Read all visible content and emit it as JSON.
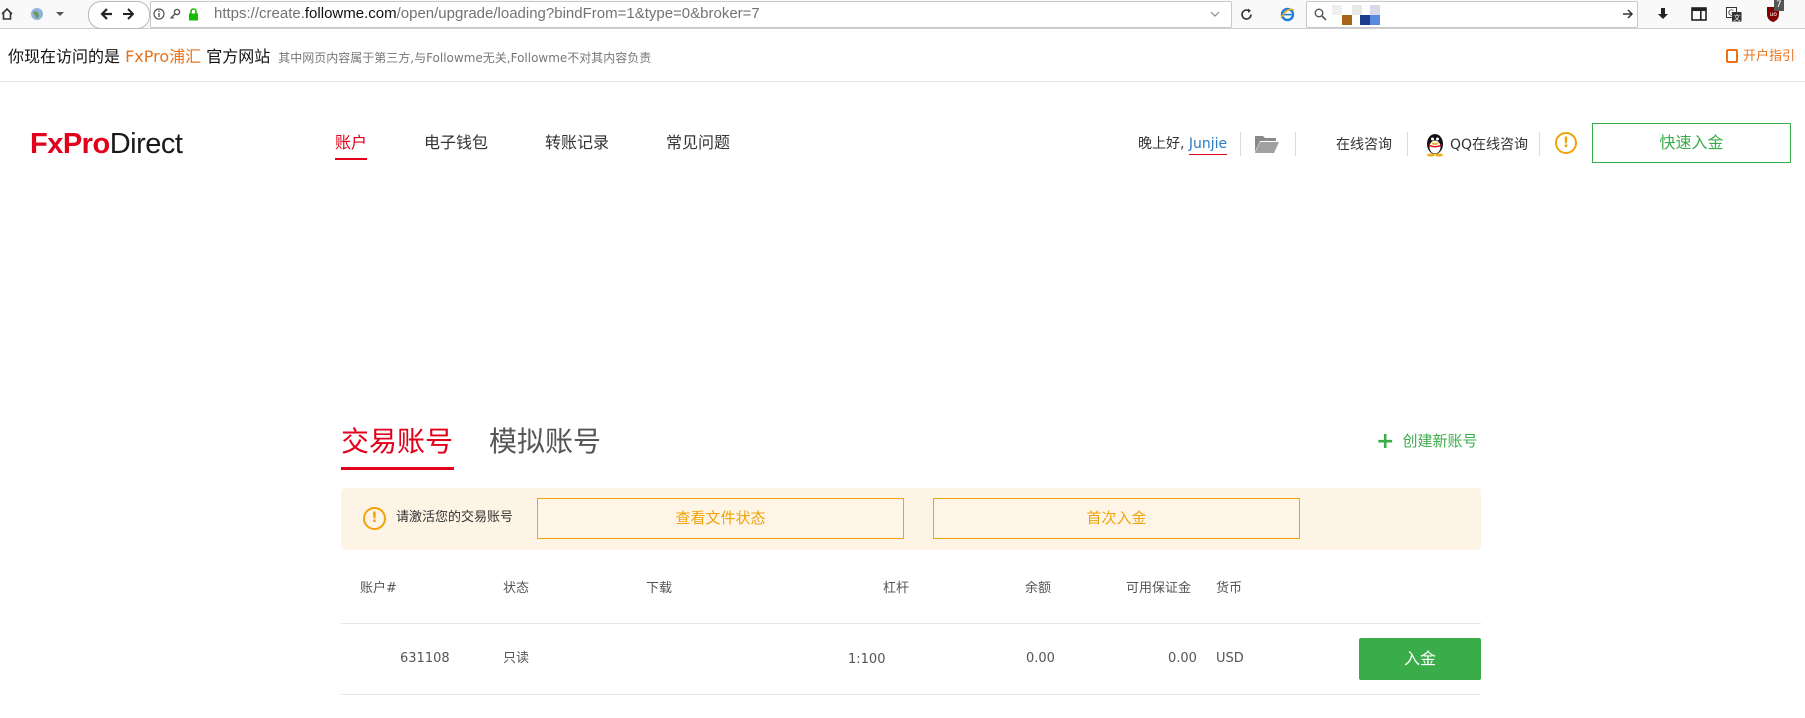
{
  "browser": {
    "url_prefix": "https://create.",
    "url_host": "followme.com",
    "url_path": "/open/upgrade/loading?bindFrom=1&type=0&broker=7",
    "ublock_badge": "7"
  },
  "notice": {
    "prefix": "你现在访问的是 ",
    "brand": "FxPro浦汇",
    "suffix": " 官方网站",
    "disclaimer": "其中网页内容属于第三方,与Followme无关,Followme不对其内容负责",
    "guide": "开户指引"
  },
  "header": {
    "logo_fx": "FxPro",
    "logo_direct": "Direct",
    "nav": [
      "账户",
      "电子钱包",
      "转账记录",
      "常见问题"
    ],
    "greeting": "晚上好,",
    "username": "Junjie",
    "online_consult": "在线咨询",
    "qq_consult": "QQ在线咨询",
    "warning_glyph": "!",
    "quick_deposit": "快速入金"
  },
  "tabs": {
    "live": "交易账号",
    "demo": "模拟账号",
    "create": "创建新账号"
  },
  "alert": {
    "glyph": "!",
    "message": "请激活您的交易账号",
    "view_docs": "查看文件状态",
    "first_deposit": "首次入金"
  },
  "table": {
    "headers": [
      "账户#",
      "状态",
      "下载",
      "杠杆",
      "余额",
      "可用保证金",
      "货币"
    ],
    "rows": [
      {
        "account": "631108",
        "status": "只读",
        "download": "",
        "leverage": "1:100",
        "balance": "0.00",
        "free_margin": "0.00",
        "currency": "USD",
        "action": "入金"
      }
    ]
  },
  "colors": {
    "brand_red": "#e3001b",
    "accent_green": "#3bac4a",
    "warning_orange": "#f0a30a",
    "link_blue": "#2a7bbf"
  }
}
